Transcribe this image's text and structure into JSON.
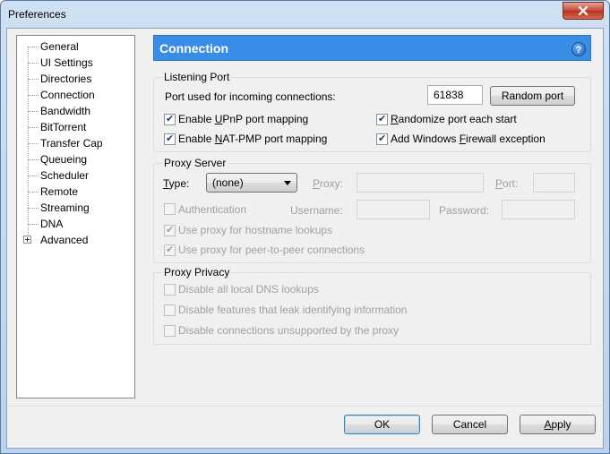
{
  "window": {
    "title": "Preferences"
  },
  "tree": {
    "items": [
      {
        "label": "General"
      },
      {
        "label": "UI Settings"
      },
      {
        "label": "Directories"
      },
      {
        "label": "Connection",
        "selected": true
      },
      {
        "label": "Bandwidth"
      },
      {
        "label": "BitTorrent"
      },
      {
        "label": "Transfer Cap"
      },
      {
        "label": "Queueing"
      },
      {
        "label": "Scheduler"
      },
      {
        "label": "Remote"
      },
      {
        "label": "Streaming"
      },
      {
        "label": "DNA"
      },
      {
        "label": "Advanced",
        "expandable": true
      }
    ]
  },
  "header": {
    "title": "Connection",
    "help_icon": "?"
  },
  "listening": {
    "legend": "Listening Port",
    "port_label": "Port used for incoming connections:",
    "port_value": "61838",
    "random_port_button": "Random port",
    "upnp": {
      "pre": "Enable ",
      "key": "U",
      "post": "PnP port mapping",
      "checked": true
    },
    "natpmp": {
      "pre": "Enable ",
      "key": "N",
      "post": "AT-PMP port mapping",
      "checked": true
    },
    "randomize": {
      "pre": "",
      "key": "R",
      "post": "andomize port each start",
      "checked": true
    },
    "firewall": {
      "pre": "Add Windows ",
      "key": "F",
      "post": "irewall exception",
      "checked": true
    }
  },
  "proxy": {
    "legend": "Proxy Server",
    "type_label": "Type:",
    "type_value": "(none)",
    "proxy_label": "Proxy:",
    "port_label": "Port:",
    "authentication": "Authentication",
    "username_label": "Username:",
    "password_label": "Password:",
    "hostname_lookups": "Use proxy for hostname lookups",
    "p2p_connections": "Use proxy for peer-to-peer connections"
  },
  "privacy": {
    "legend": "Proxy Privacy",
    "dns": "Disable all local DNS lookups",
    "leak": "Disable features that leak identifying information",
    "unsupported": "Disable connections unsupported by the proxy"
  },
  "buttons": {
    "ok": "OK",
    "cancel": "Cancel",
    "apply": "Apply"
  },
  "colors": {
    "header_bg": "#3a8de6",
    "close_button": "#c5473a"
  }
}
